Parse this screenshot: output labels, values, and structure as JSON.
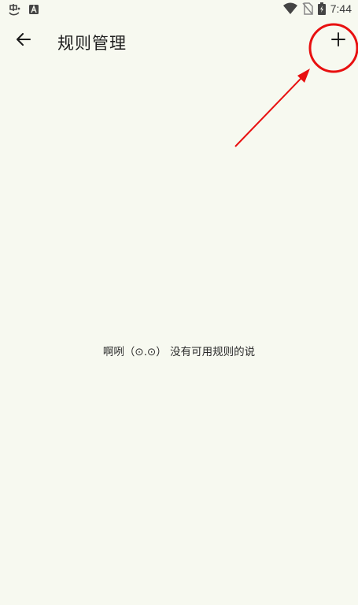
{
  "status_bar": {
    "time": "7:44",
    "icons": [
      "app-notification-icon",
      "a-notification-icon",
      "wifi-icon",
      "no-sim-icon",
      "battery-charging-icon"
    ]
  },
  "app_bar": {
    "title": "规则管理",
    "back_icon": "arrow-back-icon",
    "add_icon": "plus-icon"
  },
  "content": {
    "empty_message": "啊咧（⊙.⊙） 没有可用规则的说"
  },
  "annotation": {
    "color": "#e81010"
  },
  "colors": {
    "background": "#f7f9f0",
    "text": "#1c1c1c"
  }
}
